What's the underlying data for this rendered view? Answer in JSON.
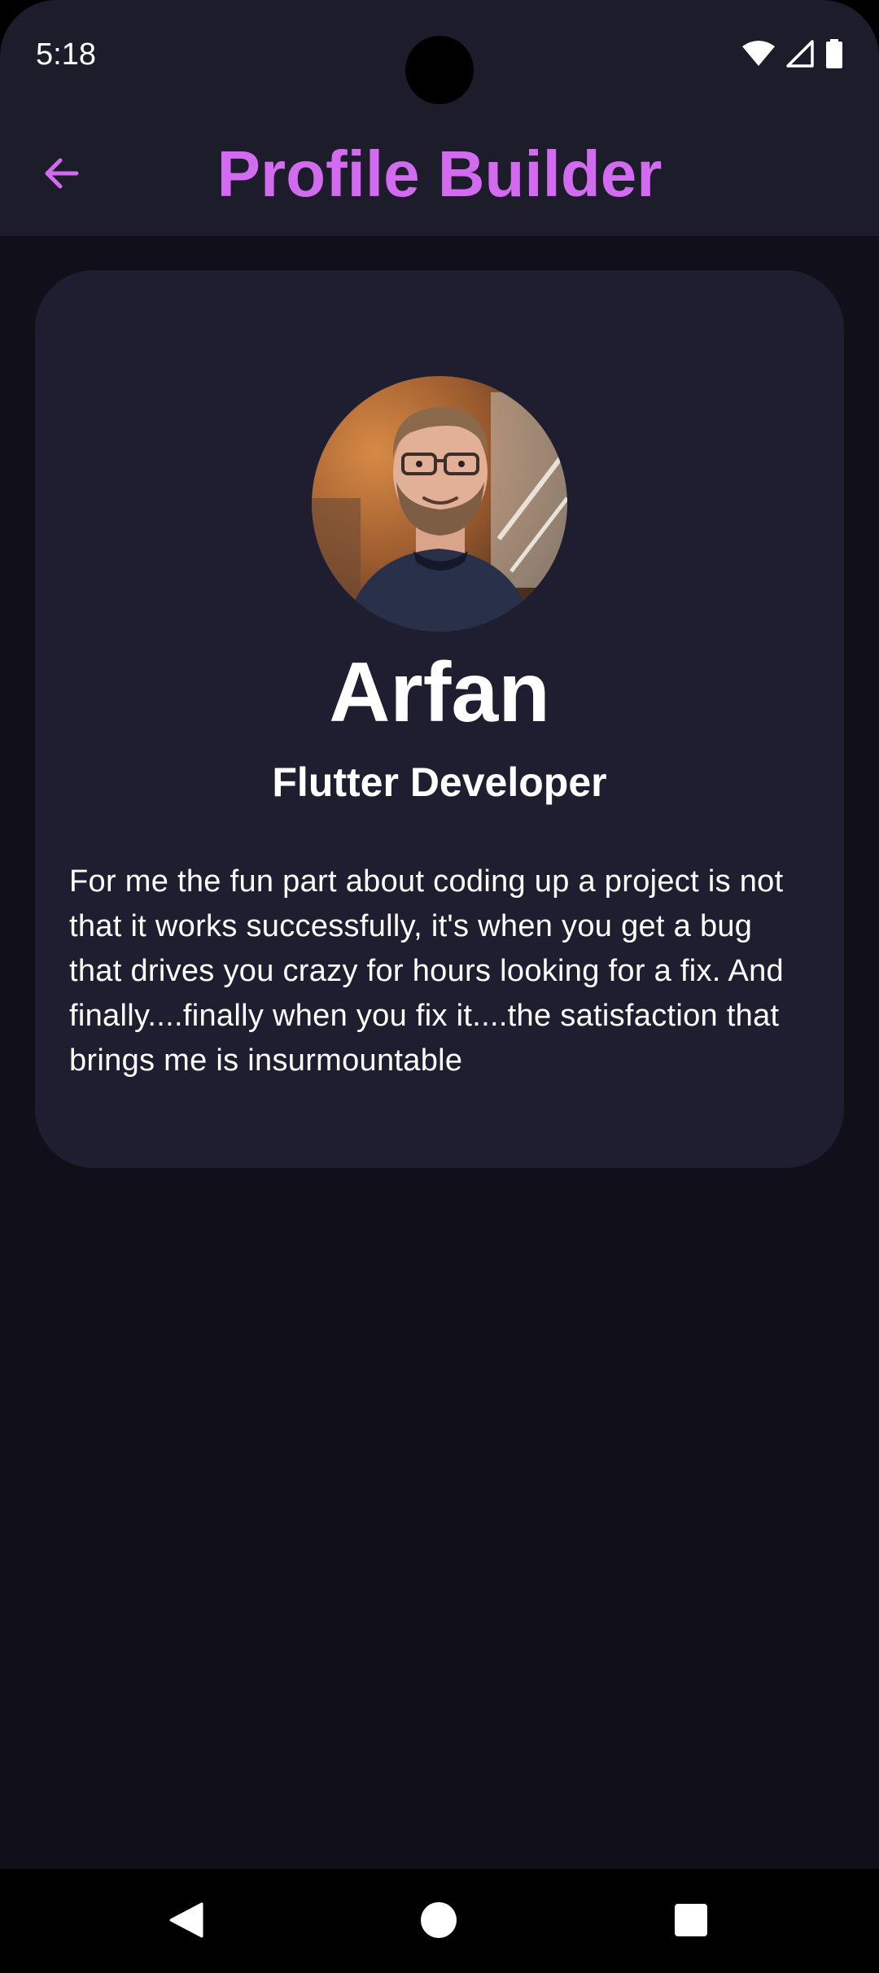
{
  "status_bar": {
    "time": "5:18",
    "icons": [
      "wifi-icon",
      "cellular-signal-icon",
      "battery-icon"
    ]
  },
  "app_bar": {
    "title": "Profile Builder",
    "back_icon": "arrow-left-icon",
    "accent_color": "#d36bf0"
  },
  "profile": {
    "avatar": "profile-photo",
    "name": "Arfan",
    "role": "Flutter Developer",
    "bio": "For me the fun part about coding up a project is not that it works successfully, it's when you get a bug that drives you crazy for hours looking for a fix. And finally....finally when you fix it....the satisfaction that brings me is insurmountable"
  },
  "nav_bar": {
    "buttons": [
      "back-triangle-icon",
      "home-circle-icon",
      "recents-square-icon"
    ]
  },
  "colors": {
    "background": "#100f1a",
    "app_bar": "#1d1c2b",
    "card": "#1f1e30",
    "text": "#ffffff"
  }
}
